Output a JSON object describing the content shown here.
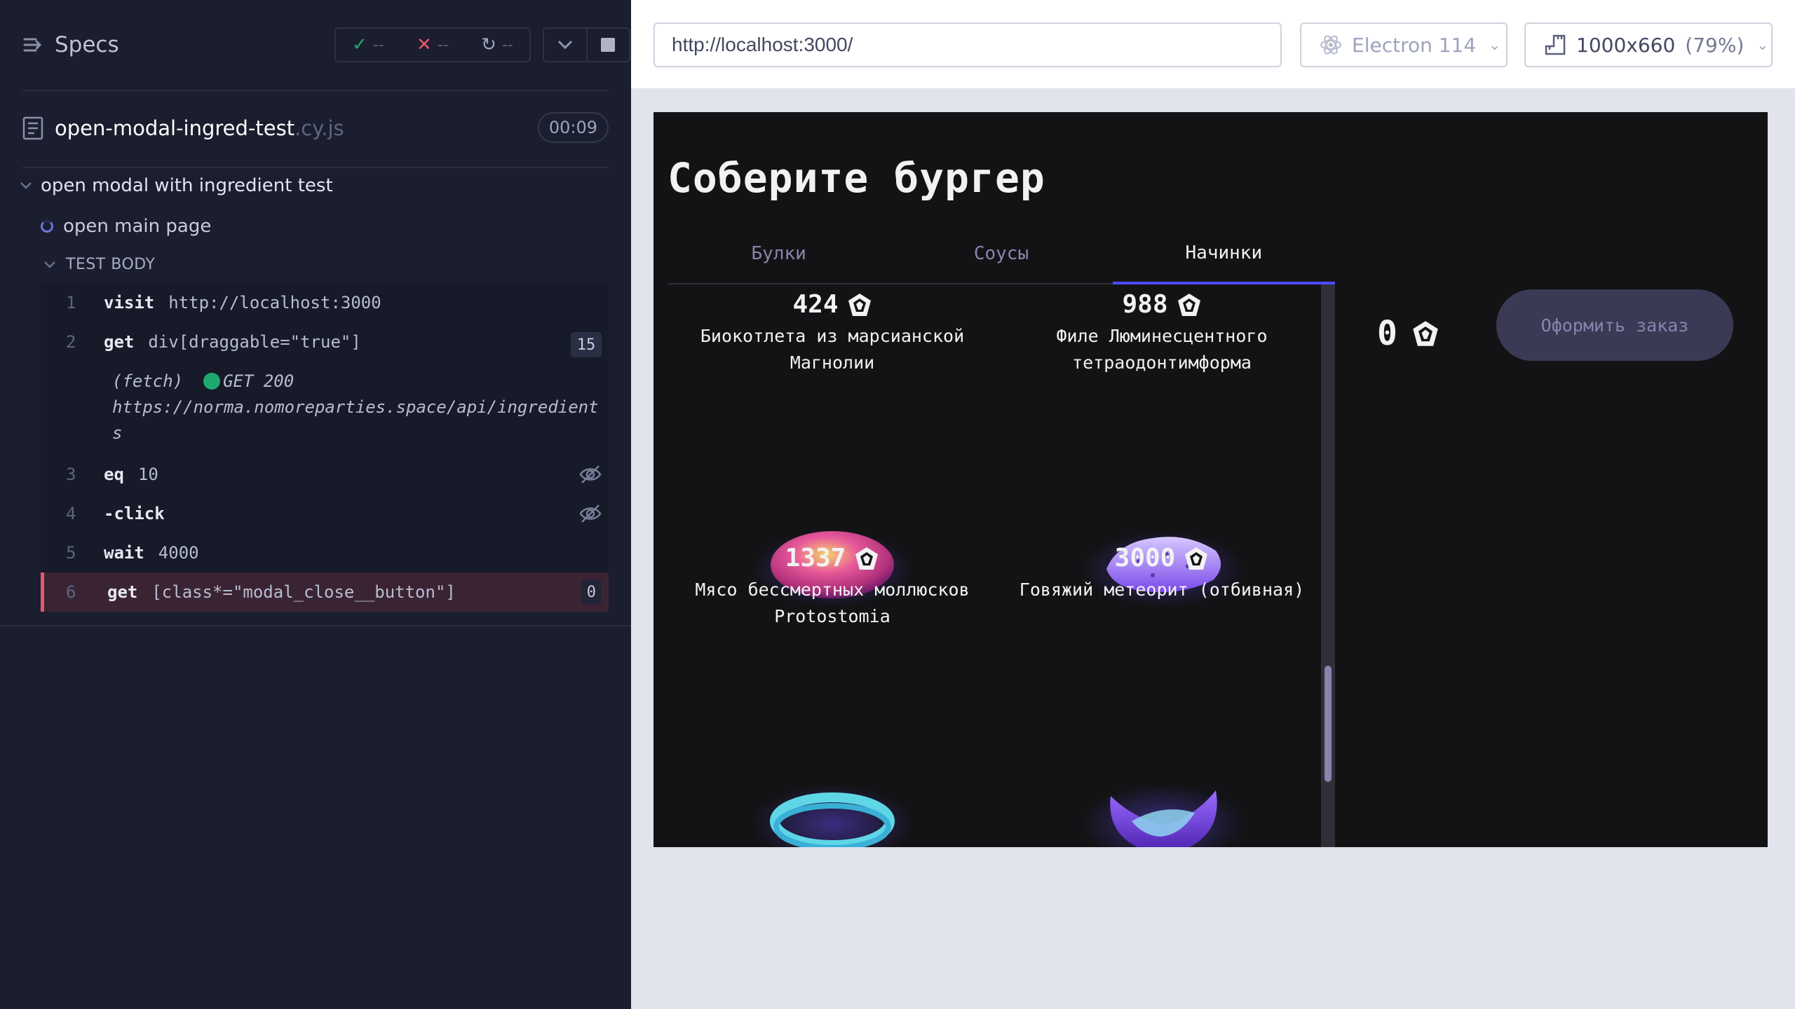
{
  "reporter": {
    "specs_label": "Specs",
    "stats": {
      "passed": "--",
      "failed": "--",
      "pending": "--"
    },
    "spec_file": {
      "name": "open-modal-ingred-test",
      "ext": ".cy.js",
      "duration": "00:09"
    },
    "suite_title": "open modal with ingredient test",
    "test_title": "open main page",
    "test_body_label": "TEST BODY",
    "commands": [
      {
        "num": "1",
        "name": "visit",
        "message": "http://localhost:3000"
      },
      {
        "num": "2",
        "name": "get",
        "message": "div[draggable=\"true\"]",
        "count": "15"
      },
      {
        "num": "3",
        "name": "eq",
        "message": "10"
      },
      {
        "num": "4",
        "name": "-click",
        "message": ""
      },
      {
        "num": "5",
        "name": "wait",
        "message": "4000"
      },
      {
        "num": "6",
        "name": "get",
        "message": "[class*=\"modal_close__button\"]",
        "count": "0"
      }
    ],
    "fetch": {
      "label": "(fetch)",
      "status": "GET 200",
      "url": "https://norma.nomoreparties.space/api/ingredients"
    }
  },
  "aut_header": {
    "url": "http://localhost:3000/",
    "browser": "Electron 114",
    "viewport": "1000x660",
    "scale": "(79%)"
  },
  "app": {
    "title": "Соберите бургер",
    "tabs": [
      "Булки",
      "Соусы",
      "Начинки"
    ],
    "ingredients": [
      {
        "price": "424",
        "name": "Биокотлета из марсианской Магнолии"
      },
      {
        "price": "988",
        "name": "Филе Люминесцентного тетраодонтимформа"
      },
      {
        "price": "1337",
        "name": "Мясо бессмертных моллюсков Protostomia"
      },
      {
        "price": "3000",
        "name": "Говяжий метеорит (отбивная)"
      }
    ],
    "total": "0",
    "order_button": "Оформить заказ"
  },
  "icons": {
    "specs": "list-arrow-icon",
    "passed": "check-icon",
    "failed": "x-icon",
    "pending": "spinner-icon",
    "currency": "crystal-currency-icon",
    "browser": "electron-icon",
    "viewport": "ruler-icon"
  },
  "colors": {
    "reporter_bg": "#1b1e2e",
    "passed": "#1fa971",
    "failed": "#e45770",
    "active_command": "#3a2434",
    "app_bg": "#131316",
    "tab_accent": "#4c4cff"
  }
}
